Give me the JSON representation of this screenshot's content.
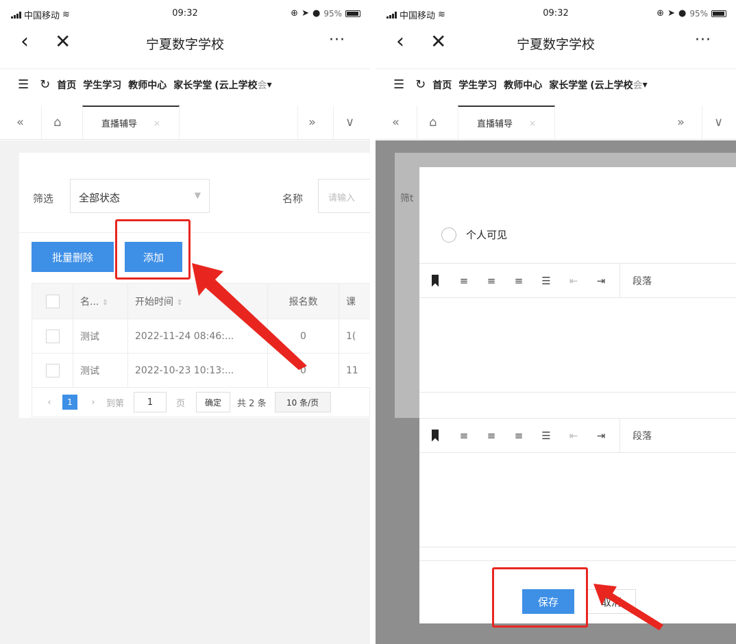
{
  "status_bar": {
    "carrier": "中国移动",
    "time": "09:32",
    "battery": "95%"
  },
  "nav": {
    "title": "宁夏数字学校",
    "back_glyph": "‹",
    "close_glyph": "✕",
    "more_glyph": "···"
  },
  "menu": {
    "menu_icon": "menu-lines-icon",
    "refresh_icon": "refresh-icon",
    "items": [
      "首页",
      "学生学习",
      "教师中心",
      "家长学堂"
    ],
    "truncated_item": "(云上学校",
    "faded_item": "会",
    "dropdown_glyph": "▾"
  },
  "tabs": {
    "double_left": "«",
    "home_icon": "home-icon",
    "active_tab": "直播辅导",
    "close": "×",
    "double_right": "»",
    "chevron_down": "∨"
  },
  "filter": {
    "label": "筛选",
    "status_value": "全部状态",
    "name_label": "名称",
    "name_placeholder": "请输入"
  },
  "actions": {
    "batch_delete": "批量删除",
    "add": "添加"
  },
  "table": {
    "headers": [
      "名...",
      "开始时间",
      "报名数",
      "课"
    ],
    "sort_glyph": "⇕",
    "rows": [
      {
        "name": "测试",
        "start": "2022-11-24 08:46:...",
        "count": "0",
        "extra": "1("
      },
      {
        "name": "测试",
        "start": "2022-10-23 10:13:...",
        "count": "0",
        "extra": "11"
      }
    ]
  },
  "pager": {
    "prev": "‹",
    "current": "1",
    "next": "›",
    "goto_label": "到第",
    "goto_value": "1",
    "page_unit": "页",
    "confirm": "确定",
    "total": "共 2 条",
    "page_size": "10 条/页"
  },
  "modal": {
    "bg_filter_label": "筛t",
    "visibility_label": "个人可见",
    "paragraph_label": "段落",
    "save": "保存",
    "cancel": "取消"
  },
  "colors": {
    "accent": "#3e8fe6",
    "highlight": "#e8261f",
    "overlay": "#8e8e8e"
  }
}
